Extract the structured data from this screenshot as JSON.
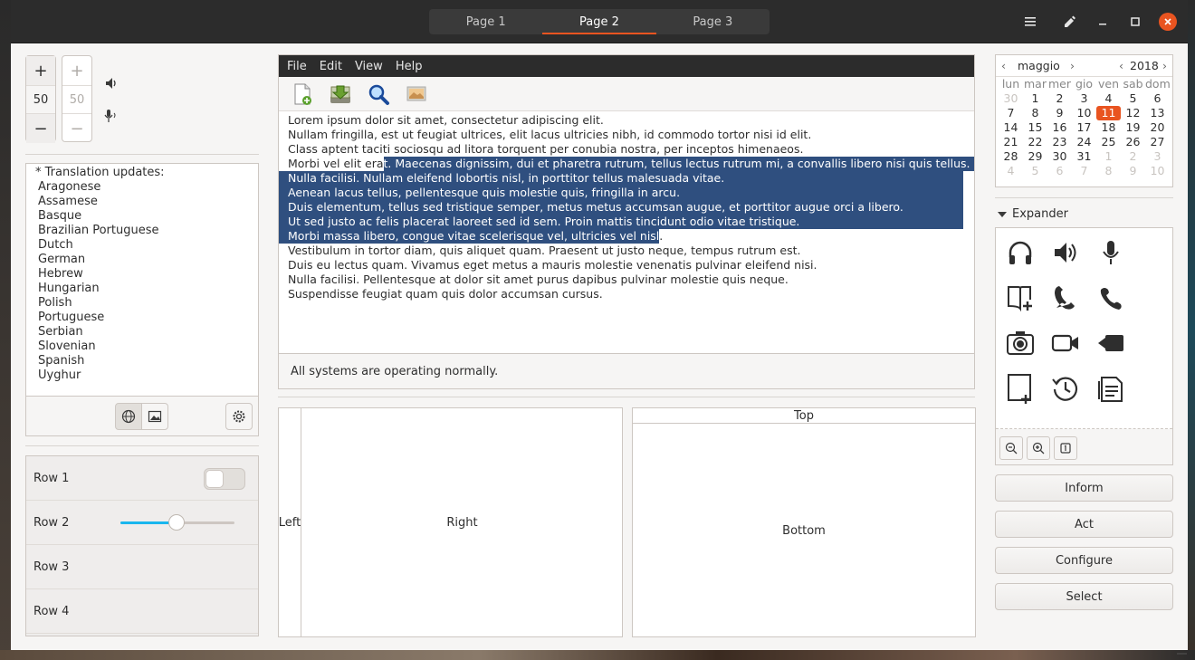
{
  "header": {
    "tabs": [
      {
        "label": "Page 1",
        "active": false
      },
      {
        "label": "Page 2",
        "active": true
      },
      {
        "label": "Page 3",
        "active": false
      }
    ],
    "controls": [
      "menu-icon",
      "pen-icon",
      "minimize-icon",
      "maximize-icon",
      "close-icon"
    ],
    "accent": "#e95420"
  },
  "spinners": {
    "primary": {
      "plus": "+",
      "value": "50",
      "minus": "−"
    },
    "secondary": {
      "plus": "+",
      "value": "50",
      "minus": "−"
    }
  },
  "languages": {
    "header": "* Translation updates:",
    "items": [
      "Aragonese",
      "Assamese",
      "Basque",
      "Brazilian Portuguese",
      "Dutch",
      "German",
      "Hebrew",
      "Hungarian",
      "Polish",
      "Portuguese",
      "Serbian",
      "Slovenian",
      "Spanish",
      "Uyghur"
    ]
  },
  "rows": [
    {
      "label": "Row 1",
      "switch_on": false
    },
    {
      "label": "Row 2",
      "slider_value": 0.49
    },
    {
      "label": "Row 3"
    },
    {
      "label": "Row 4"
    }
  ],
  "editor": {
    "menu": [
      "File",
      "Edit",
      "View",
      "Help"
    ],
    "lines": [
      "Lorem ipsum dolor sit amet, consectetur adipiscing elit.",
      "Nullam fringilla, est ut feugiat ultrices, elit lacus ultricies nibh, id commodo tortor nisi id elit.",
      "Class aptent taciti sociosqu ad litora torquent per conubia nostra, per inceptos himenaeos.",
      "Morbi vel elit era",
      "t. Maecenas dignissim, dui et pharetra rutrum, tellus lectus rutrum mi, a convallis libero nisi quis tellus.",
      "Nulla facilisi. Nullam eleifend lobortis nisl, in porttitor tellus malesuada vitae.",
      "Aenean lacus tellus, pellentesque quis molestie quis, fringilla in arcu.",
      "Duis elementum, tellus sed tristique semper, metus metus accumsan augue, et porttitor augue orci a libero.",
      "Ut sed justo ac felis placerat laoreet sed id sem. Proin mattis tincidunt odio vitae tristique.",
      "Morbi massa libero, congue vitae scelerisque vel, ultricies vel nisl",
      ".",
      "Vestibulum in tortor diam, quis aliquet quam. Praesent ut justo neque, tempus rutrum est.",
      "Duis eu lectus quam. Vivamus eget metus a mauris molestie venenatis pulvinar eleifend nisi.",
      "Nulla facilisi. Pellentesque at dolor sit amet purus dapibus pulvinar molestie quis neque.",
      "Suspendisse feugiat quam quis dolor accumsan cursus."
    ],
    "status": "All systems are operating normally.",
    "selection_color": "#2f4f7f"
  },
  "panes": {
    "left": "Left",
    "right": "Right",
    "top": "Top",
    "bottom": "Bottom"
  },
  "calendar": {
    "month": "maggio",
    "year": "2018",
    "daynames": [
      "lun",
      "mar",
      "mer",
      "gio",
      "ven",
      "sab",
      "dom"
    ],
    "weeks": [
      [
        "30",
        "1",
        "2",
        "3",
        "4",
        "5",
        "6"
      ],
      [
        "7",
        "8",
        "9",
        "10",
        "11",
        "12",
        "13"
      ],
      [
        "14",
        "15",
        "16",
        "17",
        "18",
        "19",
        "20"
      ],
      [
        "21",
        "22",
        "23",
        "24",
        "25",
        "26",
        "27"
      ],
      [
        "28",
        "29",
        "30",
        "31",
        "1",
        "2",
        "3"
      ],
      [
        "4",
        "5",
        "6",
        "7",
        "8",
        "9",
        "10"
      ]
    ],
    "selected": "11"
  },
  "expander": {
    "label": "Expander",
    "icons": [
      "headphones-icon",
      "speaker-icon",
      "microphone-icon",
      "address-book-add-icon",
      "phone-icon",
      "hangup-icon",
      "camera-photo-icon",
      "camera-video-icon",
      "media-record-icon",
      "document-new-icon",
      "history-icon",
      "notes-icon"
    ]
  },
  "buttons": [
    "Inform",
    "Act",
    "Configure",
    "Select"
  ]
}
